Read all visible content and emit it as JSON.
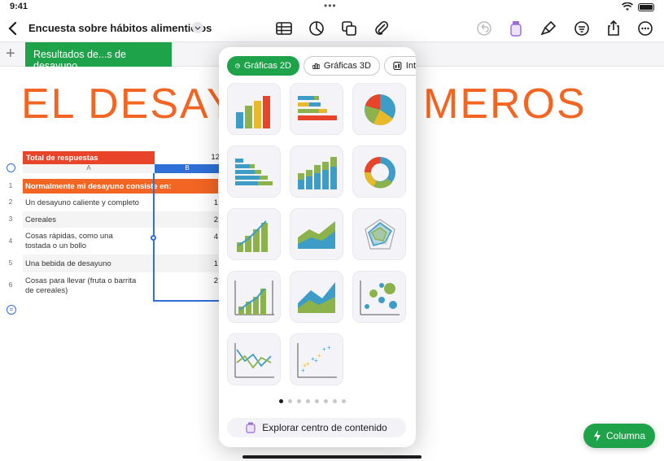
{
  "status": {
    "time": "9:41",
    "dots": "•••"
  },
  "toolbar": {
    "title": "Encuesta sobre hábitos alimenticios"
  },
  "sheets": {
    "add": "+",
    "active_tab": "Resultados de...s de desayuno"
  },
  "canvas": {
    "title_left": "EL DESAYUN",
    "title_right": "MEROS"
  },
  "table": {
    "total_label": "Total de respuestas",
    "total_value": "12",
    "col_a": "A",
    "col_b": "B",
    "header": "Normalmente mi desayuno consiste en:",
    "rows": [
      {
        "num": "1",
        "label": "",
        "value": ""
      },
      {
        "num": "2",
        "label": "Un desayuno caliente y completo",
        "value": "1"
      },
      {
        "num": "3",
        "label": "Cereales",
        "value": "2"
      },
      {
        "num": "4",
        "label": "Cosas rápidas, como una tostada o un bollo",
        "value": "4"
      },
      {
        "num": "5",
        "label": "Una bebida de desayuno",
        "value": "1"
      },
      {
        "num": "6",
        "label": "Cosas para llevar (fruta o barrita de cereales)",
        "value": "2"
      }
    ],
    "eq": "="
  },
  "popover": {
    "tabs": [
      "Gráficas 2D",
      "Gráficas 3D",
      "Int"
    ],
    "explore": "Explorar centro de contenido",
    "page_count": 8,
    "active_page": 0
  },
  "fab": {
    "label": "Columna"
  },
  "colors": {
    "green": "#1fa34a",
    "orange": "#f26522",
    "red": "#e8442a",
    "blue": "#2f6fd6"
  }
}
